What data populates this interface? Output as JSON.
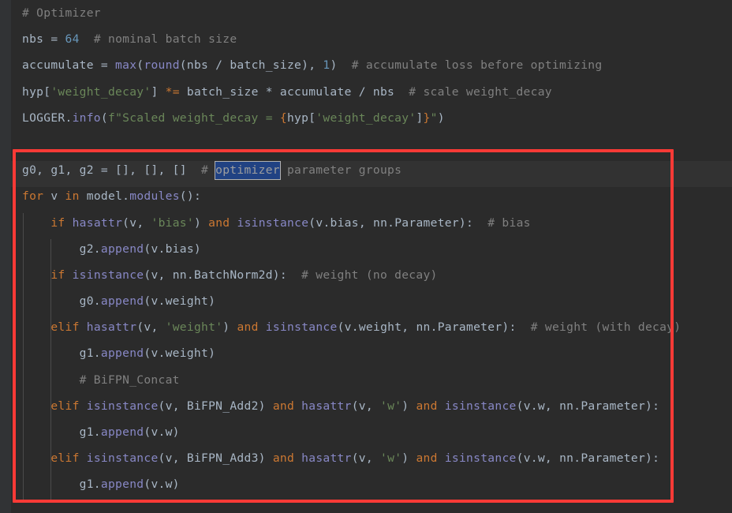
{
  "editor": {
    "theme": "darcula",
    "background": "#2B2B2B",
    "gutter_background": "#313335",
    "current_line_background": "#323232",
    "default_text_color": "#A9B7C6",
    "keyword_color": "#CC7832",
    "number_color": "#6897BB",
    "string_color": "#6A8759",
    "comment_color": "#808080",
    "function_color": "#8888C6",
    "selection_background": "#214283",
    "annotation_border_color": "#F93A36"
  },
  "selection": {
    "selected_word": "optimizer"
  },
  "code": {
    "lines": [
      {
        "id": "line-comment-optimizer",
        "indent": 0,
        "plain": "# Optimizer",
        "tokens": [
          {
            "t": "# Optimizer",
            "c": "cmt"
          }
        ]
      },
      {
        "id": "line-nbs",
        "indent": 0,
        "plain": "nbs = 64  # nominal batch size",
        "tokens": [
          {
            "t": "nbs = ",
            "c": "def"
          },
          {
            "t": "64",
            "c": "num"
          },
          {
            "t": "  ",
            "c": "def"
          },
          {
            "t": "# nominal batch size",
            "c": "cmt"
          }
        ]
      },
      {
        "id": "line-accumulate",
        "indent": 0,
        "plain": "accumulate = max(round(nbs / batch_size), 1)  # accumulate loss before optimizing",
        "tokens": [
          {
            "t": "accumulate = ",
            "c": "def"
          },
          {
            "t": "max",
            "c": "fn"
          },
          {
            "t": "(",
            "c": "def"
          },
          {
            "t": "round",
            "c": "fn"
          },
          {
            "t": "(nbs / batch_size), ",
            "c": "def"
          },
          {
            "t": "1",
            "c": "num"
          },
          {
            "t": ")  ",
            "c": "def"
          },
          {
            "t": "# accumulate loss before optimizing",
            "c": "cmt"
          }
        ]
      },
      {
        "id": "line-weight-decay-scale",
        "indent": 0,
        "plain": "hyp['weight_decay'] *= batch_size * accumulate / nbs  # scale weight_decay",
        "tokens": [
          {
            "t": "hyp[",
            "c": "def"
          },
          {
            "t": "'weight_decay'",
            "c": "str"
          },
          {
            "t": "] ",
            "c": "def"
          },
          {
            "t": "*=",
            "c": "kw"
          },
          {
            "t": " batch_size * accumulate / nbs  ",
            "c": "def"
          },
          {
            "t": "# scale weight_decay",
            "c": "cmt"
          }
        ]
      },
      {
        "id": "line-logger-info",
        "indent": 0,
        "plain": "LOGGER.info(f\"Scaled weight_decay = {hyp['weight_decay']}\")",
        "tokens": [
          {
            "t": "LOGGER.",
            "c": "def"
          },
          {
            "t": "info",
            "c": "fn"
          },
          {
            "t": "(",
            "c": "def"
          },
          {
            "t": "f\"Scaled weight_decay = ",
            "c": "str"
          },
          {
            "t": "{",
            "c": "fstr-brace"
          },
          {
            "t": "hyp[",
            "c": "def"
          },
          {
            "t": "'weight_decay'",
            "c": "str"
          },
          {
            "t": "]",
            "c": "def"
          },
          {
            "t": "}",
            "c": "fstr-brace"
          },
          {
            "t": "\"",
            "c": "str"
          },
          {
            "t": ")",
            "c": "def"
          }
        ]
      },
      {
        "id": "line-blank-1",
        "indent": 0,
        "plain": "",
        "tokens": []
      },
      {
        "id": "line-g-groups",
        "indent": 0,
        "highlighted": true,
        "plain": "g0, g1, g2 = [], [], []  # optimizer parameter groups",
        "tokens": [
          {
            "t": "g0, g1, g2 = [], [], []  ",
            "c": "def"
          },
          {
            "t": "# ",
            "c": "cmt"
          },
          {
            "t": "optimizer",
            "c": "cmt",
            "sel": true
          },
          {
            "t": " parameter groups",
            "c": "cmt"
          }
        ]
      },
      {
        "id": "line-for-modules",
        "indent": 0,
        "plain": "for v in model.modules():",
        "tokens": [
          {
            "t": "for",
            "c": "kw"
          },
          {
            "t": " v ",
            "c": "def"
          },
          {
            "t": "in",
            "c": "kw"
          },
          {
            "t": " model.",
            "c": "def"
          },
          {
            "t": "modules",
            "c": "fn"
          },
          {
            "t": "():",
            "c": "def"
          }
        ]
      },
      {
        "id": "line-if-bias",
        "indent": 1,
        "plain": "    if hasattr(v, 'bias') and isinstance(v.bias, nn.Parameter):  # bias",
        "tokens": [
          {
            "t": "    ",
            "c": "def"
          },
          {
            "t": "if",
            "c": "kw"
          },
          {
            "t": " ",
            "c": "def"
          },
          {
            "t": "hasattr",
            "c": "fn"
          },
          {
            "t": "(v, ",
            "c": "def"
          },
          {
            "t": "'bias'",
            "c": "str"
          },
          {
            "t": ") ",
            "c": "def"
          },
          {
            "t": "and",
            "c": "kw"
          },
          {
            "t": " ",
            "c": "def"
          },
          {
            "t": "isinstance",
            "c": "fn"
          },
          {
            "t": "(v.bias, nn.Parameter):  ",
            "c": "def"
          },
          {
            "t": "# bias",
            "c": "cmt"
          }
        ]
      },
      {
        "id": "line-g2-append-bias",
        "indent": 2,
        "plain": "        g2.append(v.bias)",
        "tokens": [
          {
            "t": "        g2.",
            "c": "def"
          },
          {
            "t": "append",
            "c": "fn"
          },
          {
            "t": "(v.bias)",
            "c": "def"
          }
        ]
      },
      {
        "id": "line-if-batchnorm",
        "indent": 1,
        "plain": "    if isinstance(v, nn.BatchNorm2d):  # weight (no decay)",
        "tokens": [
          {
            "t": "    ",
            "c": "def"
          },
          {
            "t": "if",
            "c": "kw"
          },
          {
            "t": " ",
            "c": "def"
          },
          {
            "t": "isinstance",
            "c": "fn"
          },
          {
            "t": "(v, nn.BatchNorm2d):  ",
            "c": "def"
          },
          {
            "t": "# weight (no decay)",
            "c": "cmt"
          }
        ]
      },
      {
        "id": "line-g0-append-weight",
        "indent": 2,
        "plain": "        g0.append(v.weight)",
        "tokens": [
          {
            "t": "        g0.",
            "c": "def"
          },
          {
            "t": "append",
            "c": "fn"
          },
          {
            "t": "(v.weight)",
            "c": "def"
          }
        ]
      },
      {
        "id": "line-elif-hasattr-weight",
        "indent": 1,
        "plain": "    elif hasattr(v, 'weight') and isinstance(v.weight, nn.Parameter):  # weight (with decay)",
        "tokens": [
          {
            "t": "    ",
            "c": "def"
          },
          {
            "t": "elif",
            "c": "kw"
          },
          {
            "t": " ",
            "c": "def"
          },
          {
            "t": "hasattr",
            "c": "fn"
          },
          {
            "t": "(v, ",
            "c": "def"
          },
          {
            "t": "'weight'",
            "c": "str"
          },
          {
            "t": ") ",
            "c": "def"
          },
          {
            "t": "and",
            "c": "kw"
          },
          {
            "t": " ",
            "c": "def"
          },
          {
            "t": "isinstance",
            "c": "fn"
          },
          {
            "t": "(v.weight, nn.Parameter):  ",
            "c": "def"
          },
          {
            "t": "# weight (with decay)",
            "c": "cmt"
          }
        ]
      },
      {
        "id": "line-g1-append-weight",
        "indent": 2,
        "plain": "        g1.append(v.weight)",
        "tokens": [
          {
            "t": "        g1.",
            "c": "def"
          },
          {
            "t": "append",
            "c": "fn"
          },
          {
            "t": "(v.weight)",
            "c": "def"
          }
        ]
      },
      {
        "id": "line-comment-bifpn-concat",
        "indent": 2,
        "plain": "        # BiFPN_Concat",
        "tokens": [
          {
            "t": "        ",
            "c": "def"
          },
          {
            "t": "# BiFPN_Concat",
            "c": "cmt"
          }
        ]
      },
      {
        "id": "line-elif-bifpn-add2",
        "indent": 1,
        "plain": "    elif isinstance(v, BiFPN_Add2) and hasattr(v, 'w') and isinstance(v.w, nn.Parameter):",
        "tokens": [
          {
            "t": "    ",
            "c": "def"
          },
          {
            "t": "elif",
            "c": "kw"
          },
          {
            "t": " ",
            "c": "def"
          },
          {
            "t": "isinstance",
            "c": "fn"
          },
          {
            "t": "(v, BiFPN_Add2) ",
            "c": "def"
          },
          {
            "t": "and",
            "c": "kw"
          },
          {
            "t": " ",
            "c": "def"
          },
          {
            "t": "hasattr",
            "c": "fn"
          },
          {
            "t": "(v, ",
            "c": "def"
          },
          {
            "t": "'w'",
            "c": "str"
          },
          {
            "t": ") ",
            "c": "def"
          },
          {
            "t": "and",
            "c": "kw"
          },
          {
            "t": " ",
            "c": "def"
          },
          {
            "t": "isinstance",
            "c": "fn"
          },
          {
            "t": "(v.w, nn.Parameter):",
            "c": "def"
          }
        ]
      },
      {
        "id": "line-g1-append-w-1",
        "indent": 2,
        "plain": "        g1.append(v.w)",
        "tokens": [
          {
            "t": "        g1.",
            "c": "def"
          },
          {
            "t": "append",
            "c": "fn"
          },
          {
            "t": "(v.w)",
            "c": "def"
          }
        ]
      },
      {
        "id": "line-elif-bifpn-add3",
        "indent": 1,
        "plain": "    elif isinstance(v, BiFPN_Add3) and hasattr(v, 'w') and isinstance(v.w, nn.Parameter):",
        "tokens": [
          {
            "t": "    ",
            "c": "def"
          },
          {
            "t": "elif",
            "c": "kw"
          },
          {
            "t": " ",
            "c": "def"
          },
          {
            "t": "isinstance",
            "c": "fn"
          },
          {
            "t": "(v, BiFPN_Add3) ",
            "c": "def"
          },
          {
            "t": "and",
            "c": "kw"
          },
          {
            "t": " ",
            "c": "def"
          },
          {
            "t": "hasattr",
            "c": "fn"
          },
          {
            "t": "(v, ",
            "c": "def"
          },
          {
            "t": "'w'",
            "c": "str"
          },
          {
            "t": ") ",
            "c": "def"
          },
          {
            "t": "and",
            "c": "kw"
          },
          {
            "t": " ",
            "c": "def"
          },
          {
            "t": "isinstance",
            "c": "fn"
          },
          {
            "t": "(v.w, nn.Parameter):",
            "c": "def"
          }
        ]
      },
      {
        "id": "line-g1-append-w-2",
        "indent": 2,
        "plain": "        g1.append(v.w)",
        "tokens": [
          {
            "t": "        g1.",
            "c": "def"
          },
          {
            "t": "append",
            "c": "fn"
          },
          {
            "t": "(v.w)",
            "c": "def"
          }
        ]
      }
    ]
  }
}
